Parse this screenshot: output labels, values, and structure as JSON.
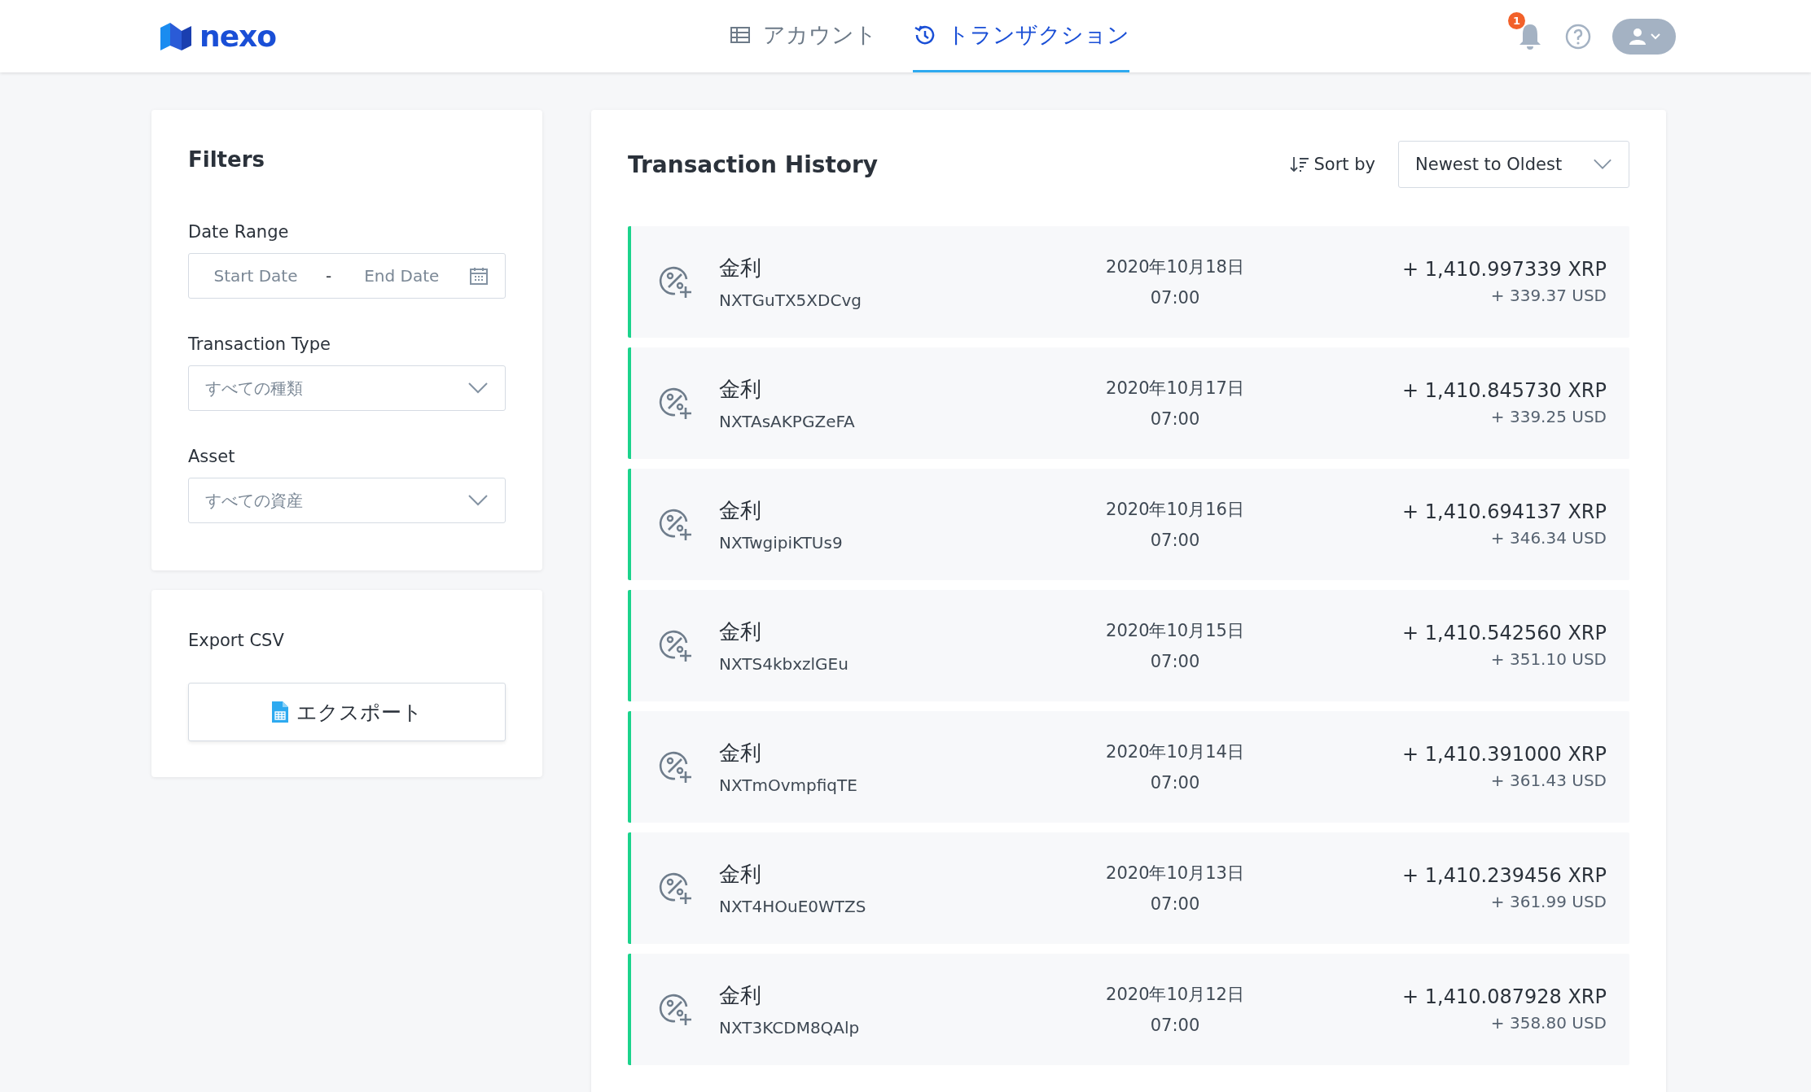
{
  "header": {
    "logo": "nexo",
    "nav": [
      {
        "label": "アカウント",
        "selected": false
      },
      {
        "label": "トランザクション",
        "selected": true
      }
    ],
    "notification_count": "1"
  },
  "filters": {
    "title": "Filters",
    "date_range": {
      "label": "Date Range",
      "start_placeholder": "Start Date",
      "separator": "-",
      "end_placeholder": "End Date"
    },
    "transaction_type": {
      "label": "Transaction Type",
      "value": "すべての種類"
    },
    "asset": {
      "label": "Asset",
      "value": "すべての資産"
    }
  },
  "export": {
    "title": "Export CSV",
    "button": "エクスポート"
  },
  "history": {
    "title": "Transaction History",
    "sort_label": "Sort by",
    "sort_value": "Newest to Oldest",
    "rows": [
      {
        "type": "金利",
        "id": "NXTGuTX5XDCvg",
        "date": "2020年10月18日",
        "time": "07:00",
        "amount": "+ 1,410.997339 XRP",
        "usd": "+ 339.37 USD"
      },
      {
        "type": "金利",
        "id": "NXTAsAKPGZeFA",
        "date": "2020年10月17日",
        "time": "07:00",
        "amount": "+ 1,410.845730 XRP",
        "usd": "+ 339.25 USD"
      },
      {
        "type": "金利",
        "id": "NXTwgipiKTUs9",
        "date": "2020年10月16日",
        "time": "07:00",
        "amount": "+ 1,410.694137 XRP",
        "usd": "+ 346.34 USD"
      },
      {
        "type": "金利",
        "id": "NXTS4kbxzlGEu",
        "date": "2020年10月15日",
        "time": "07:00",
        "amount": "+ 1,410.542560 XRP",
        "usd": "+ 351.10 USD"
      },
      {
        "type": "金利",
        "id": "NXTmOvmpfiqTE",
        "date": "2020年10月14日",
        "time": "07:00",
        "amount": "+ 1,410.391000 XRP",
        "usd": "+ 361.43 USD"
      },
      {
        "type": "金利",
        "id": "NXT4HOuE0WTZS",
        "date": "2020年10月13日",
        "time": "07:00",
        "amount": "+ 1,410.239456 XRP",
        "usd": "+ 361.99 USD"
      },
      {
        "type": "金利",
        "id": "NXT3KCDM8QAlp",
        "date": "2020年10月12日",
        "time": "07:00",
        "amount": "+ 1,410.087928 XRP",
        "usd": "+ 358.80 USD"
      }
    ]
  }
}
